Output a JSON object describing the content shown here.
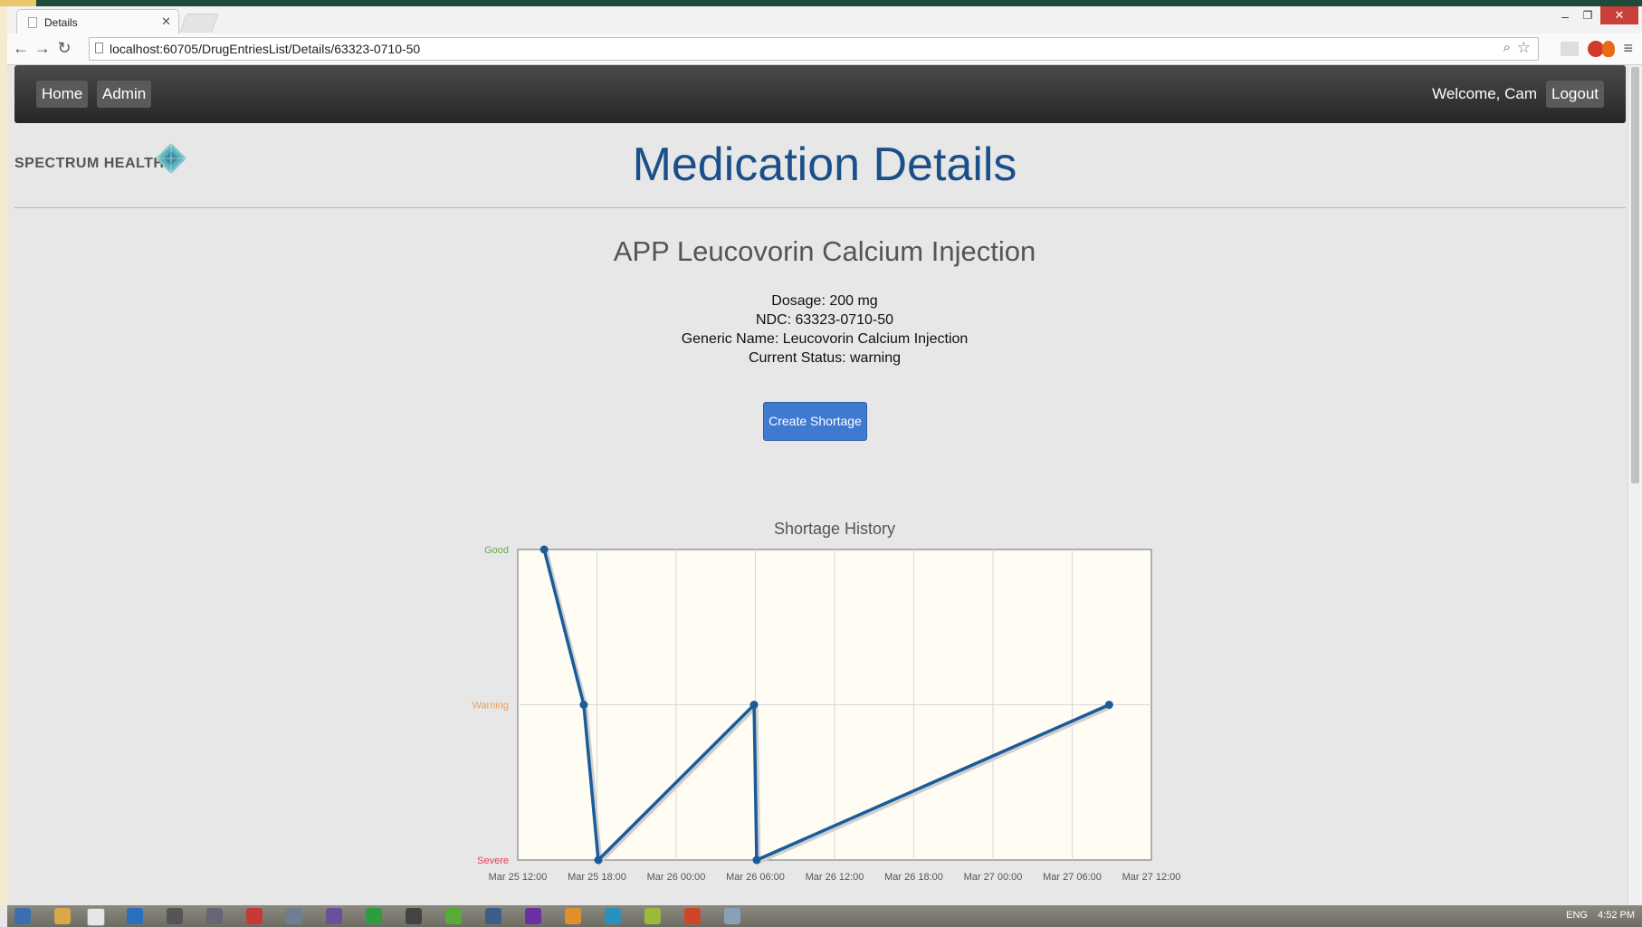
{
  "browser": {
    "tab_title": "Details",
    "url": "localhost:60705/DrugEntriesList/Details/63323-0710-50"
  },
  "navbar": {
    "home": "Home",
    "admin": "Admin",
    "welcome": "Welcome, Cam",
    "logout": "Logout"
  },
  "logo_text": "SPECTRUM HEALTH",
  "page_title": "Medication Details",
  "drug": {
    "name": "APP Leucovorin Calcium Injection",
    "dosage": "Dosage: 200 mg",
    "ndc": "NDC: 63323-0710-50",
    "generic": "Generic Name: Leucovorin Calcium Injection",
    "status": "Current Status: warning"
  },
  "create_button": "Create Shortage",
  "chart_data": {
    "type": "line",
    "title": "Shortage History",
    "y_categories": [
      "Severe",
      "Warning",
      "Good"
    ],
    "y_colors": [
      "#e04050",
      "#f0a050",
      "#6aa84f"
    ],
    "x_ticks": [
      "Mar 25 12:00",
      "Mar 25 18:00",
      "Mar 26 00:00",
      "Mar 26 06:00",
      "Mar 26 12:00",
      "Mar 26 18:00",
      "Mar 27 00:00",
      "Mar 27 06:00",
      "Mar 27 12:00"
    ],
    "xlim_hours": [
      0,
      48
    ],
    "series": [
      {
        "color": "#1a5c99",
        "points": [
          {
            "t": "Mar 25 14:00",
            "x": 2.0,
            "y": 2
          },
          {
            "t": "Mar 25 17:00",
            "x": 5.0,
            "y": 1
          },
          {
            "t": "Mar 25 18:10",
            "x": 6.1,
            "y": 0
          },
          {
            "t": "Mar 26 05:55",
            "x": 17.9,
            "y": 1
          },
          {
            "t": "Mar 26 06:05",
            "x": 18.1,
            "y": 0
          },
          {
            "t": "Mar 27 08:50",
            "x": 44.8,
            "y": 1
          }
        ]
      }
    ]
  },
  "taskbar": {
    "lang": "ENG",
    "time": "4:52 PM"
  }
}
